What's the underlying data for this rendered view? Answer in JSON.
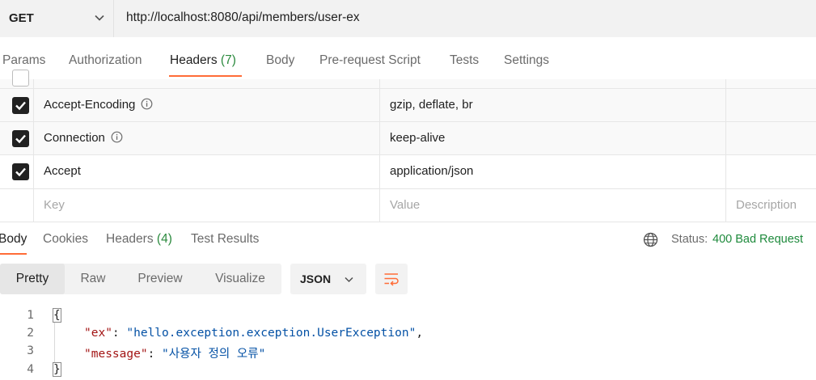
{
  "request": {
    "method": "GET",
    "url": "http://localhost:8080/api/members/user-ex"
  },
  "request_tabs": [
    {
      "label": "Params"
    },
    {
      "label": "Authorization"
    },
    {
      "label": "Headers",
      "count": "(7)"
    },
    {
      "label": "Body"
    },
    {
      "label": "Pre-request Script"
    },
    {
      "label": "Tests"
    },
    {
      "label": "Settings"
    }
  ],
  "headers_table": {
    "rows": [
      {
        "key": "Accept-Encoding",
        "value": "gzip, deflate, br",
        "checked": true,
        "info": true
      },
      {
        "key": "Connection",
        "value": "keep-alive",
        "checked": true,
        "info": true
      },
      {
        "key": "Accept",
        "value": "application/json",
        "checked": true,
        "info": false
      }
    ],
    "new_row": {
      "key_placeholder": "Key",
      "value_placeholder": "Value",
      "description_placeholder": "Description"
    }
  },
  "response_tabs": [
    {
      "label": "Body"
    },
    {
      "label": "Cookies"
    },
    {
      "label": "Headers",
      "count": "(4)"
    },
    {
      "label": "Test Results"
    }
  ],
  "status": {
    "label": "Status:",
    "value": "400 Bad Request",
    "color": "#1e8a3c"
  },
  "view_modes": [
    "Pretty",
    "Raw",
    "Preview",
    "Visualize"
  ],
  "format": "JSON",
  "icons": {
    "method": "chevron-down-icon",
    "globe": "globe-icon",
    "wrap": "wrap-lines-icon",
    "info": "info-icon"
  },
  "code": {
    "line_numbers": [
      "1",
      "2",
      "3",
      "4"
    ],
    "open_brace": "{",
    "close_brace": "}",
    "fields": [
      {
        "key": "\"ex\"",
        "sep": ": ",
        "value": "\"hello.exception.exception.UserException\"",
        "trail": ","
      },
      {
        "key": "\"message\"",
        "sep": ": ",
        "value": "\"사용자 정의 오류\"",
        "trail": ""
      }
    ]
  },
  "accent_color": "#ff6c37"
}
